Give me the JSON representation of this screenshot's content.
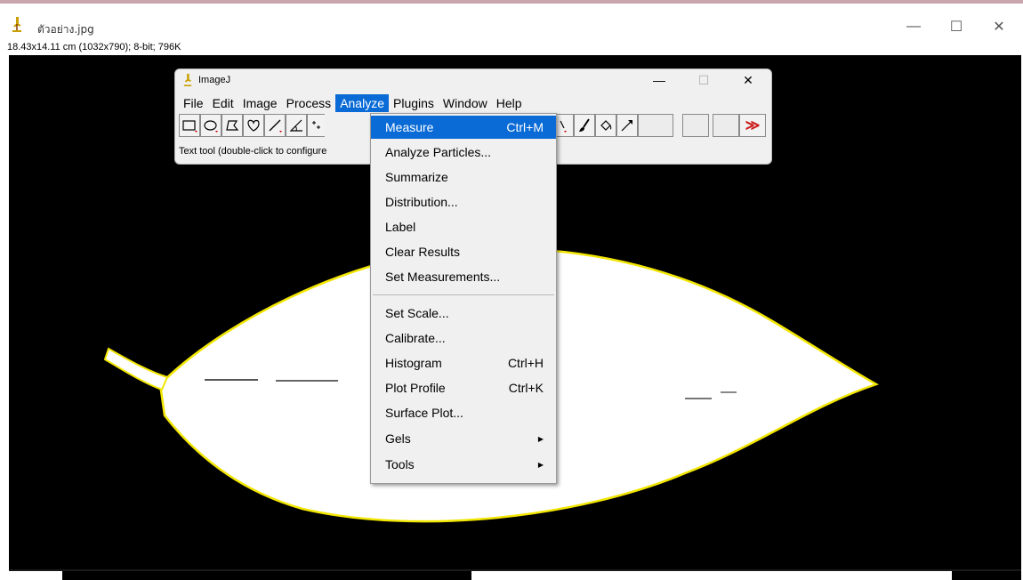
{
  "image_window": {
    "title": "ตัวอย่าง.jpg",
    "info": "18.43x14.11 cm (1032x790); 8-bit; 796K",
    "controls": [
      "—",
      "☐",
      "✕"
    ]
  },
  "imagej": {
    "title": "ImageJ",
    "controls": [
      "—",
      "☐",
      "✕"
    ],
    "menu": [
      "File",
      "Edit",
      "Image",
      "Process",
      "Analyze",
      "Plugins",
      "Window",
      "Help"
    ],
    "active_menu": "Analyze",
    "status": "Text tool (double-click to configure",
    "overflow_glyph": "≫"
  },
  "analyze_menu": {
    "items": [
      {
        "label": "Measure",
        "shortcut": "Ctrl+M"
      },
      {
        "label": "Analyze Particles...",
        "shortcut": ""
      },
      {
        "label": "Summarize",
        "shortcut": ""
      },
      {
        "label": "Distribution...",
        "shortcut": ""
      },
      {
        "label": "Label",
        "shortcut": ""
      },
      {
        "label": "Clear Results",
        "shortcut": ""
      },
      {
        "label": "Set Measurements...",
        "shortcut": ""
      },
      {
        "label": "Set Scale...",
        "shortcut": ""
      },
      {
        "label": "Calibrate...",
        "shortcut": ""
      },
      {
        "label": "Histogram",
        "shortcut": "Ctrl+H"
      },
      {
        "label": "Plot Profile",
        "shortcut": "Ctrl+K"
      },
      {
        "label": "Surface Plot...",
        "shortcut": ""
      },
      {
        "label": "Gels",
        "shortcut": ""
      },
      {
        "label": "Tools",
        "shortcut": ""
      }
    ],
    "submenu_arrow": "▶"
  },
  "colors": {
    "highlight": "#0a6bd6",
    "leaf": "#ffffff",
    "outline": "#f2e600",
    "canvas": "#000000",
    "overflow_red": "#cc1a1a"
  }
}
